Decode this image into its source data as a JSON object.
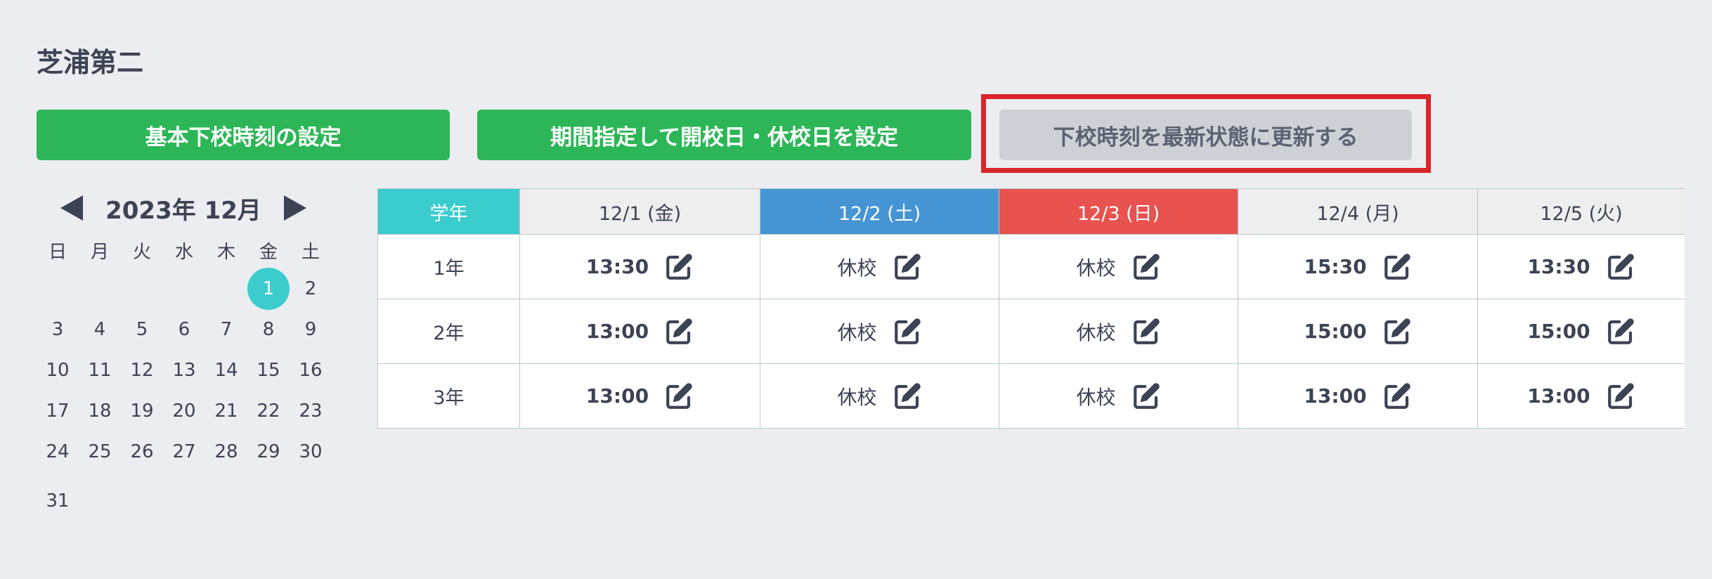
{
  "school": {
    "name": "芝浦第二"
  },
  "buttons": {
    "basic": "基本下校時刻の設定",
    "period": "期間指定して開校日・休校日を設定",
    "refresh": "下校時刻を最新状態に更新する"
  },
  "colors": {
    "green": "#2db657",
    "teal": "#3bcccd",
    "saturday": "#4595d4",
    "sunday": "#e8524f",
    "highlight": "#d9262a"
  },
  "calendar": {
    "title": "2023年 12月",
    "prev_icon": "triangle-left-icon",
    "next_icon": "triangle-right-icon",
    "weekdays": [
      "日",
      "月",
      "火",
      "水",
      "木",
      "金",
      "土"
    ],
    "selected_day": "1",
    "weeks": [
      [
        "",
        "",
        "",
        "",
        "",
        "1",
        "2"
      ],
      [
        "3",
        "4",
        "5",
        "6",
        "7",
        "8",
        "9"
      ],
      [
        "10",
        "11",
        "12",
        "13",
        "14",
        "15",
        "16"
      ],
      [
        "17",
        "18",
        "19",
        "20",
        "21",
        "22",
        "23"
      ],
      [
        "24",
        "25",
        "26",
        "27",
        "28",
        "29",
        "30"
      ],
      [
        "31",
        "",
        "",
        "",
        "",
        "",
        ""
      ]
    ]
  },
  "table": {
    "grade_header": "学年",
    "days": [
      "12/1 (金)",
      "12/2 (土)",
      "12/3 (日)",
      "12/4 (月)",
      "12/5 (火)"
    ],
    "rows": [
      {
        "grade": "1年",
        "cells": [
          "13:30",
          "休校",
          "休校",
          "15:30",
          "13:30"
        ]
      },
      {
        "grade": "2年",
        "cells": [
          "13:00",
          "休校",
          "休校",
          "15:00",
          "15:00"
        ]
      },
      {
        "grade": "3年",
        "cells": [
          "13:00",
          "休校",
          "休校",
          "13:00",
          "13:00"
        ]
      }
    ]
  }
}
